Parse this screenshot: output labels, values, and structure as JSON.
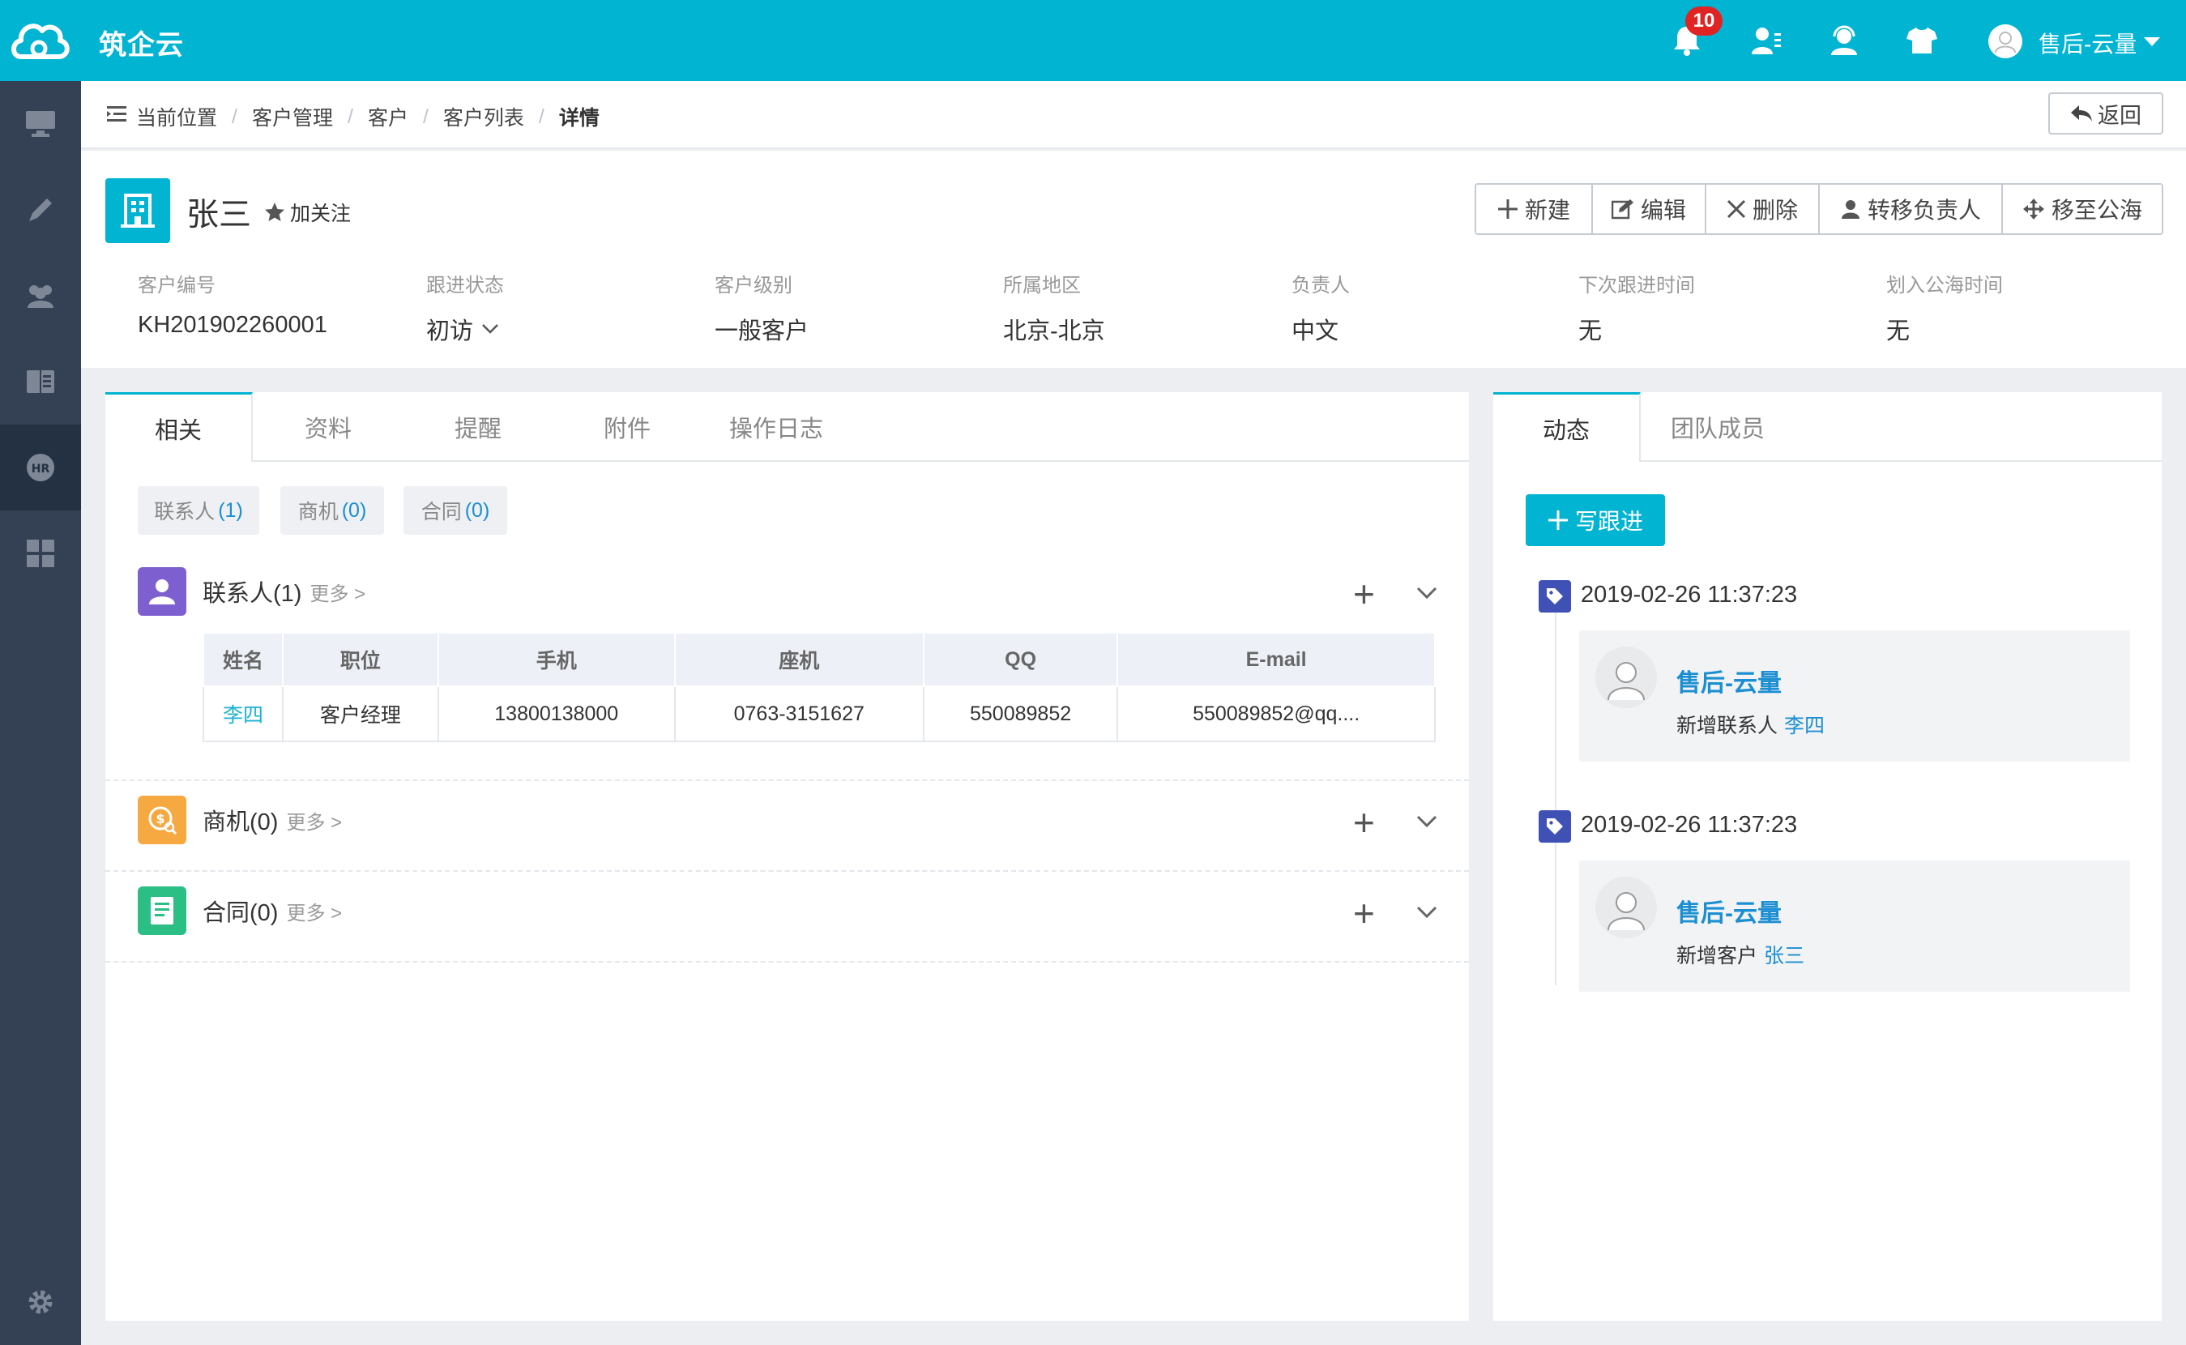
{
  "app": {
    "title": "筑企云",
    "notification_count": "10",
    "user_name": "售后-云量"
  },
  "colors": {
    "primary": "#00b4d2",
    "sidebar": "#344054",
    "link": "#1b8fd1",
    "badge": "#e02424"
  },
  "sidebar": {
    "items": [
      "monitor-icon",
      "pencil-icon",
      "people-icon",
      "book-icon",
      "hr-icon",
      "grid-icon",
      "gear-icon"
    ]
  },
  "breadcrumb": {
    "items": [
      "当前位置",
      "客户管理",
      "客户",
      "客户列表"
    ],
    "current": "详情"
  },
  "back_label": "返回",
  "customer": {
    "name": "张三",
    "follow_label": "加关注"
  },
  "actions": {
    "new": "新建",
    "edit": "编辑",
    "delete": "删除",
    "transfer": "转移负责人",
    "move": "移至公海"
  },
  "info": [
    {
      "label": "客户编号",
      "value": "KH201902260001"
    },
    {
      "label": "跟进状态",
      "value": "初访"
    },
    {
      "label": "客户级别",
      "value": "一般客户"
    },
    {
      "label": "所属地区",
      "value": "北京-北京"
    },
    {
      "label": "负责人",
      "value": "中文"
    },
    {
      "label": "下次跟进时间",
      "value": "无"
    },
    {
      "label": "划入公海时间",
      "value": "无"
    }
  ],
  "left_tabs": [
    "相关",
    "资料",
    "提醒",
    "附件",
    "操作日志"
  ],
  "chips": [
    {
      "label": "联系人",
      "count": "(1)"
    },
    {
      "label": "商机",
      "count": "(0)"
    },
    {
      "label": "合同",
      "count": "(0)"
    }
  ],
  "sections": [
    {
      "title": "联系人(1)",
      "more": "更多 >"
    },
    {
      "title": "商机(0)",
      "more": "更多 >"
    },
    {
      "title": "合同(0)",
      "more": "更多 >"
    }
  ],
  "contacts_table": {
    "headers": [
      "姓名",
      "职位",
      "手机",
      "座机",
      "QQ",
      "E-mail"
    ],
    "rows": [
      [
        "李四",
        "客户经理",
        "13800138000",
        "0763-3151627",
        "550089852",
        "550089852@qq...."
      ]
    ]
  },
  "right_tabs": [
    "动态",
    "团队成员"
  ],
  "write_label": "写跟进",
  "timeline": [
    {
      "time": "2019-02-26 11:37:23",
      "user": "售后-云量",
      "desc": "新增联系人",
      "target": "李四"
    },
    {
      "time": "2019-02-26 11:37:23",
      "user": "售后-云量",
      "desc": "新增客户",
      "target": "张三"
    }
  ]
}
